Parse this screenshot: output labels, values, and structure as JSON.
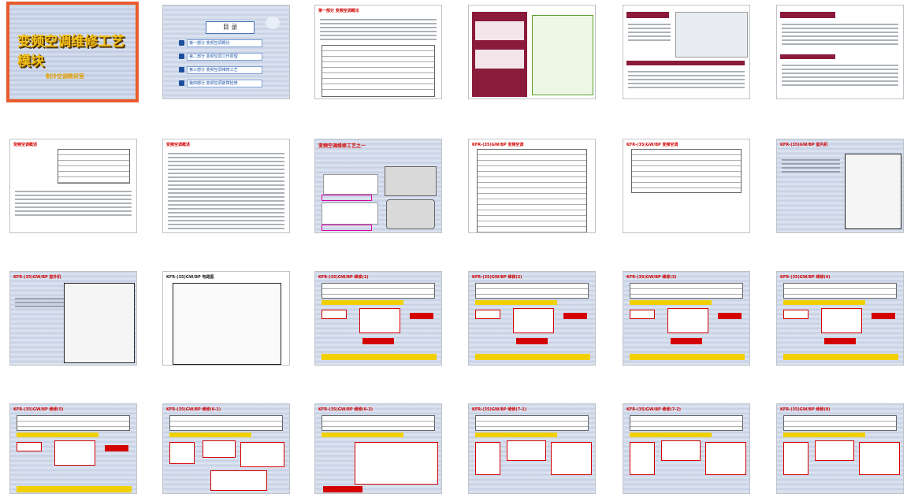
{
  "cover": {
    "title": "变频空调维修工艺模块",
    "subtitle": "制冷空调教研室"
  },
  "toc": {
    "title": "目 录",
    "items": [
      "第一部分 变频空调概论",
      "第二部分 变频空调工作原理",
      "第三部分 变频空调维修工艺",
      "第四部分 变频空调故障检修"
    ]
  },
  "slides": [
    {
      "header": "变频空调维修工艺模块"
    },
    {
      "header": "目录"
    },
    {
      "header": "第一部分 变频空调概论"
    },
    {
      "header": "变频空调概述"
    },
    {
      "header": "变频空调概述"
    },
    {
      "header": "变频空调概述"
    },
    {
      "header": "变频空调概述"
    },
    {
      "header": "变频空调概述"
    },
    {
      "header": "变频空调维修工艺之一"
    },
    {
      "header": "KFR-(35)GW/BP 变频空调"
    },
    {
      "header": "KFR-(35)GW/BP 变频空调"
    },
    {
      "header": "KFR-(35)GW/BP 室内机"
    },
    {
      "header": "KFR-(35)GW/BP 室外机"
    },
    {
      "header": "KFR-(35)GW/BP 电路图"
    },
    {
      "header": "KFR-(35)GW/BP 维修(1)"
    },
    {
      "header": "KFR-(35)GW/BP 维修(2)"
    },
    {
      "header": "KFR-(35)GW/BP 维修(3)"
    },
    {
      "header": "KFR-(35)GW/BP 维修(4)"
    },
    {
      "header": "KFR-(35)GW/BP 维修(5)"
    },
    {
      "header": "KFR-(35)GW/BP 维修(6-1)"
    },
    {
      "header": "KFR-(35)GW/BP 维修(6-2)"
    },
    {
      "header": "KFR-(35)GW/BP 维修(7-1)"
    },
    {
      "header": "KFR-(35)GW/BP 维修(7-2)"
    },
    {
      "header": "KFR-(35)GW/BP 维修(8)"
    }
  ]
}
